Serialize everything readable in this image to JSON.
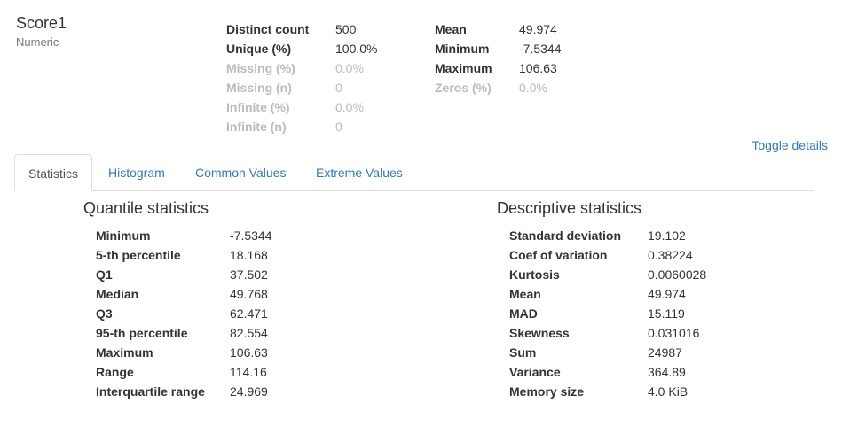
{
  "variable": {
    "name": "Score1",
    "type": "Numeric"
  },
  "overview_left": [
    {
      "key": "Distinct count",
      "value": "500",
      "muted": false
    },
    {
      "key": "Unique (%)",
      "value": "100.0%",
      "muted": false
    },
    {
      "key": "Missing (%)",
      "value": "0.0%",
      "muted": true
    },
    {
      "key": "Missing (n)",
      "value": "0",
      "muted": true
    },
    {
      "key": "Infinite (%)",
      "value": "0.0%",
      "muted": true
    },
    {
      "key": "Infinite (n)",
      "value": "0",
      "muted": true
    }
  ],
  "overview_right": [
    {
      "key": "Mean",
      "value": "49.974",
      "muted": false
    },
    {
      "key": "Minimum",
      "value": "-7.5344",
      "muted": false
    },
    {
      "key": "Maximum",
      "value": "106.63",
      "muted": false
    },
    {
      "key": "Zeros (%)",
      "value": "0.0%",
      "muted": true
    }
  ],
  "toggle_label": "Toggle details",
  "tabs": [
    {
      "label": "Statistics",
      "active": true
    },
    {
      "label": "Histogram",
      "active": false
    },
    {
      "label": "Common Values",
      "active": false
    },
    {
      "label": "Extreme Values",
      "active": false
    }
  ],
  "quantile": {
    "title": "Quantile statistics",
    "rows": [
      {
        "key": "Minimum",
        "value": "-7.5344"
      },
      {
        "key": "5-th percentile",
        "value": "18.168"
      },
      {
        "key": "Q1",
        "value": "37.502"
      },
      {
        "key": "Median",
        "value": "49.768"
      },
      {
        "key": "Q3",
        "value": "62.471"
      },
      {
        "key": "95-th percentile",
        "value": "82.554"
      },
      {
        "key": "Maximum",
        "value": "106.63"
      },
      {
        "key": "Range",
        "value": "114.16"
      },
      {
        "key": "Interquartile range",
        "value": "24.969"
      }
    ]
  },
  "descriptive": {
    "title": "Descriptive statistics",
    "rows": [
      {
        "key": "Standard deviation",
        "value": "19.102"
      },
      {
        "key": "Coef of variation",
        "value": "0.38224"
      },
      {
        "key": "Kurtosis",
        "value": "0.0060028"
      },
      {
        "key": "Mean",
        "value": "49.974"
      },
      {
        "key": "MAD",
        "value": "15.119"
      },
      {
        "key": "Skewness",
        "value": "0.031016"
      },
      {
        "key": "Sum",
        "value": "24987"
      },
      {
        "key": "Variance",
        "value": "364.89"
      },
      {
        "key": "Memory size",
        "value": "4.0 KiB"
      }
    ]
  }
}
